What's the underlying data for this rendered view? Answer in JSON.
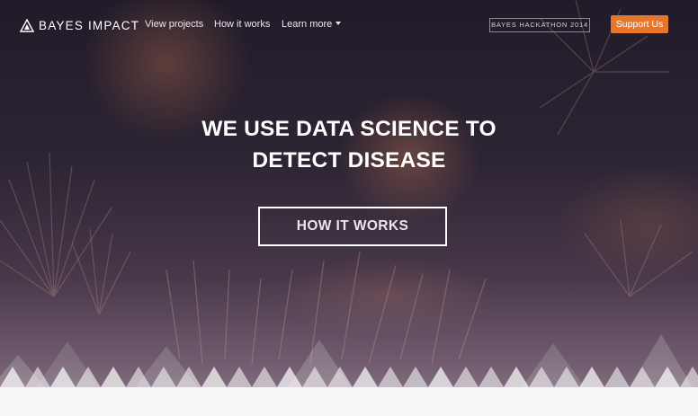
{
  "brand": {
    "name": "BAYES IMPACT",
    "logo_icon": "triangle-logo-icon"
  },
  "nav": {
    "items": [
      {
        "label": "View projects"
      },
      {
        "label": "How it works"
      },
      {
        "label": "Learn more"
      }
    ],
    "hackathon_label": "BAYES HACKATHON 2014",
    "support_label": "Support Us"
  },
  "hero": {
    "headline_line1": "WE USE DATA SCIENCE TO",
    "headline_line2": "DETECT DISEASE",
    "cta_label": "HOW IT WORKS"
  },
  "colors": {
    "accent": "#e5762a",
    "text": "#ffffff",
    "hero_dark": "#211b29",
    "page_bg": "#f8f6f4"
  }
}
